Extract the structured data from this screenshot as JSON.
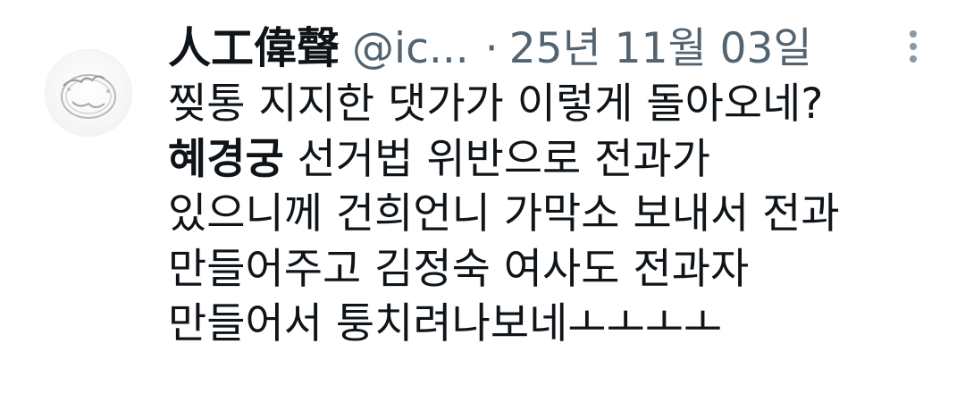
{
  "tweet": {
    "author": {
      "display_name": "人工偉聲",
      "handle": "@ic...",
      "avatar_icon": "ring-necklace-avatar-icon"
    },
    "separator": "·",
    "date": "25년 11월 03일",
    "more_icon": "vertical-dots-icon",
    "body": {
      "line1": "찢통 지지한 댓가가 이렇게 돌아오네?",
      "line2_bold": "혜경궁",
      "line2_rest": " 선거법 위반으로 전과가",
      "line3": "있으니께 건희언니 가막소 보내서 전과",
      "line4": "만들어주고 김정숙 여사도 전과자",
      "line5": "만들어서 퉁치려나보네ㅗㅗㅗㅗ"
    }
  },
  "colors": {
    "text_primary": "#0f1419",
    "text_secondary": "#536471",
    "background": "#ffffff"
  }
}
